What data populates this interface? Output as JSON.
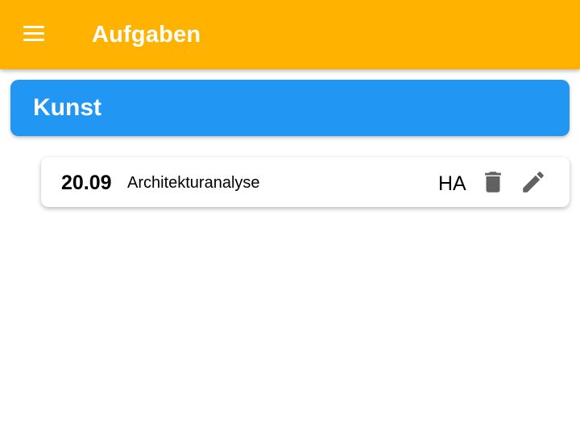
{
  "appbar": {
    "title": "Aufgaben",
    "menu_icon": "hamburger-menu-icon",
    "background_color": "#FFB300"
  },
  "subject": {
    "name": "Kunst",
    "background_color": "#2196F3"
  },
  "tasks": [
    {
      "date": "20.09",
      "title": "Architekturanalyse",
      "type": "HA",
      "delete_icon": "trash-icon",
      "edit_icon": "pencil-icon"
    }
  ],
  "colors": {
    "icon_gray": "#616161",
    "text": "#000000"
  }
}
